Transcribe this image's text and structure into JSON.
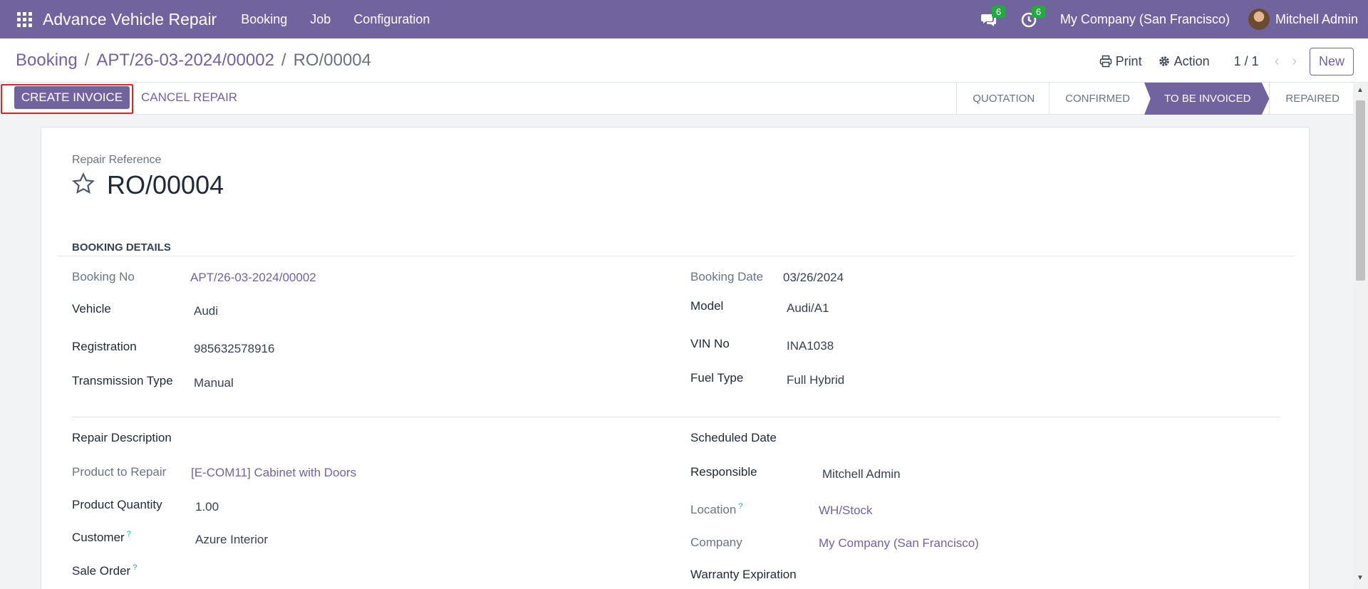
{
  "navbar": {
    "app_title": "Advance Vehicle Repair",
    "menu": [
      "Booking",
      "Job",
      "Configuration"
    ],
    "messages_count": "6",
    "activities_count": "6",
    "company": "My Company (San Francisco)",
    "user": "Mitchell Admin"
  },
  "breadcrumb": {
    "items": [
      "Booking",
      "APT/26-03-2024/00002",
      "RO/00004"
    ],
    "separator": "/"
  },
  "control": {
    "print_label": "Print",
    "action_label": "Action",
    "pager": "1 / 1",
    "new_label": "New"
  },
  "statusbar": {
    "create_invoice": "CREATE INVOICE",
    "cancel_repair": "CANCEL REPAIR",
    "stages": [
      "QUOTATION",
      "CONFIRMED",
      "TO BE INVOICED",
      "REPAIRED"
    ],
    "active_stage": "TO BE INVOICED"
  },
  "form": {
    "ref_label": "Repair Reference",
    "ref_value": "RO/00004",
    "section_booking": "BOOKING DETAILS",
    "booking_no_label": "Booking No",
    "booking_no": "APT/26-03-2024/00002",
    "booking_date_label": "Booking Date",
    "booking_date": "03/26/2024",
    "vehicle_label": "Vehicle",
    "vehicle": "Audi",
    "model_label": "Model",
    "model": "Audi/A1",
    "registration_label": "Registration",
    "registration": "985632578916",
    "vin_label": "VIN No",
    "vin": "INA1038",
    "transmission_label": "Transmission Type",
    "transmission": "Manual",
    "fuel_label": "Fuel Type",
    "fuel": "Full Hybrid",
    "repair_desc_label": "Repair Description",
    "scheduled_date_label": "Scheduled Date",
    "product_label": "Product to Repair",
    "product": "[E-COM11] Cabinet with Doors",
    "responsible_label": "Responsible",
    "responsible": "Mitchell Admin",
    "quantity_label": "Product Quantity",
    "quantity": "1.00",
    "location_label": "Location",
    "location": "WH/Stock",
    "customer_label": "Customer",
    "customer": "Azure Interior",
    "company_label": "Company",
    "company": "My Company (San Francisco)",
    "sale_order_label": "Sale Order",
    "warranty_label": "Warranty Expiration",
    "help_mark": "?"
  },
  "colors": {
    "brand": "#71639e",
    "badge": "#28a745",
    "highlight": "#e02424"
  }
}
